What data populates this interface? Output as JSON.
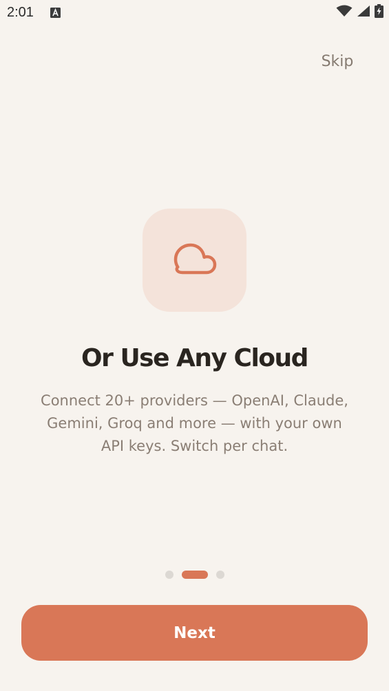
{
  "status_bar": {
    "time": "2:01",
    "notification_icon": "text-a-icon",
    "wifi_icon": "wifi-icon",
    "signal_icon": "cellular-signal-icon",
    "battery_icon": "battery-charging-icon"
  },
  "header": {
    "skip_label": "Skip"
  },
  "slide": {
    "icon": "cloud-icon",
    "title": "Or Use Any Cloud",
    "description": "Connect 20+ providers — OpenAI, Claude, Gemini, Groq and more — with your own API keys. Switch per chat."
  },
  "pager": {
    "total_pages": 3,
    "current_page": 2
  },
  "footer": {
    "next_label": "Next"
  },
  "colors": {
    "background": "#f7f3ee",
    "accent": "#d97757",
    "icon_tile": "#f4e3da",
    "title": "#2a2520",
    "body_text": "#8a7e74"
  }
}
